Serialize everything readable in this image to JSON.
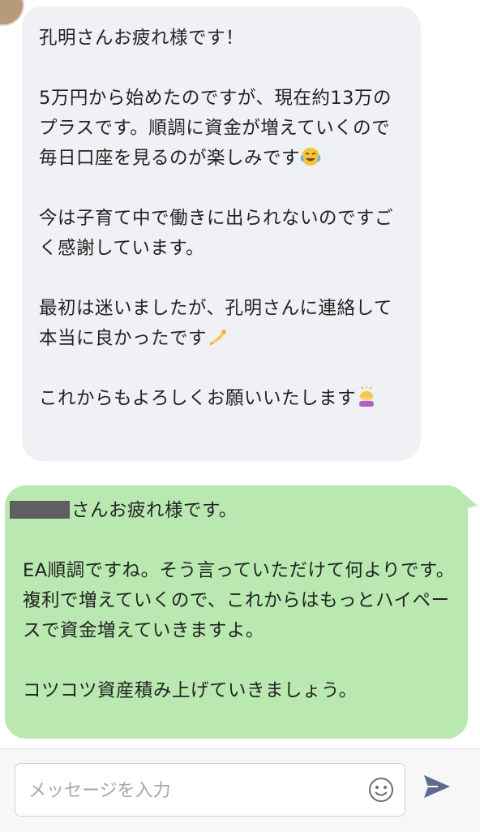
{
  "messages": [
    {
      "direction": "incoming",
      "paragraphs": [
        "孔明さんお疲れ様です！",
        "5万円から始めたのですが、現在約13万のプラスです。順調に資金が増えていくので毎日口座を見るのが楽しみです",
        "今は子育て中で働きに出られないのですごく感謝しています。",
        "最初は迷いましたが、孔明さんに連絡して本当に良かったです",
        "これからもよろしくお願いいたします"
      ],
      "emojis": [
        "face-with-tears-of-joy",
        "dizzy",
        "person-bowing"
      ]
    },
    {
      "direction": "outgoing",
      "greeting_suffix": "さんお疲れ様です。",
      "paragraphs": [
        "EA順調ですね。そう言っていただけて何よりです。\n複利で増えていくので、これからはもっとハイペースで資金増えていきますよ。",
        "コツコツ資産積み上げていきましょう。"
      ]
    }
  ],
  "composer": {
    "placeholder": "メッセージを入力",
    "emoji_icon": "smiley-icon",
    "send_icon": "send-arrow-icon"
  },
  "colors": {
    "incoming_bubble": "#f0f1f4",
    "outgoing_bubble": "#b9e9b1",
    "send_icon": "#5f6b8a"
  }
}
